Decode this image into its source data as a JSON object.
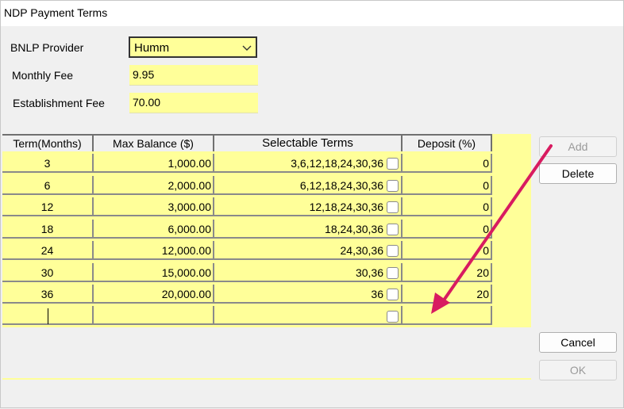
{
  "window": {
    "title": "NDP Payment Terms"
  },
  "form": {
    "provider_label": "BNLP Provider",
    "provider_value": "Humm",
    "monthly_fee_label": "Monthly Fee",
    "monthly_fee_value": "9.95",
    "establishment_fee_label": "Establishment Fee",
    "establishment_fee_value": "70.00"
  },
  "table": {
    "columns": [
      "Term(Months)",
      "Max Balance ($)",
      "Selectable Terms",
      "Deposit (%)"
    ],
    "rows": [
      {
        "term": "3",
        "max_balance": "1,000.00",
        "selectable_terms": "3,6,12,18,24,30,36",
        "deposit": "0"
      },
      {
        "term": "6",
        "max_balance": "2,000.00",
        "selectable_terms": "6,12,18,24,30,36",
        "deposit": "0"
      },
      {
        "term": "12",
        "max_balance": "3,000.00",
        "selectable_terms": "12,18,24,30,36",
        "deposit": "0"
      },
      {
        "term": "18",
        "max_balance": "6,000.00",
        "selectable_terms": "18,24,30,36",
        "deposit": "0"
      },
      {
        "term": "24",
        "max_balance": "12,000.00",
        "selectable_terms": "24,30,36",
        "deposit": "0"
      },
      {
        "term": "30",
        "max_balance": "15,000.00",
        "selectable_terms": "30,36",
        "deposit": "20"
      },
      {
        "term": "36",
        "max_balance": "20,000.00",
        "selectable_terms": "36",
        "deposit": "20"
      }
    ]
  },
  "buttons": {
    "add": "Add",
    "delete": "Delete",
    "cancel": "Cancel",
    "ok": "OK"
  },
  "icons": {
    "dropdown": "chevron-down-icon"
  },
  "colors": {
    "field_bg": "#ffff99",
    "annotation_arrow": "#d81b60"
  }
}
